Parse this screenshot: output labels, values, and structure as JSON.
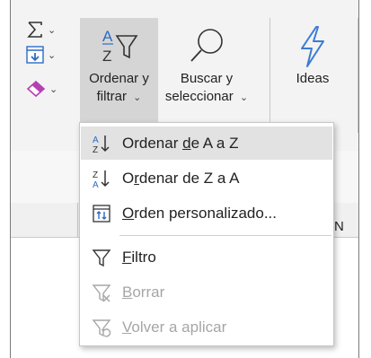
{
  "ribbon": {
    "autosum_icon": "sigma-icon",
    "fill_icon": "fill-down-icon",
    "clear_icon": "eraser-icon",
    "sort_filter": {
      "line1": "Ordenar y",
      "line2": "filtrar",
      "chevron": "⌄"
    },
    "find_select": {
      "line1": "Buscar y",
      "line2": "seleccionar",
      "chevron": "⌄"
    },
    "ideas": {
      "label": "Ideas"
    }
  },
  "sheet": {
    "column_letter": "N"
  },
  "menu": {
    "items": [
      {
        "label_pre": "Ordenar ",
        "label_key": "d",
        "label_post": "e A a Z",
        "icon": "sort-az-icon",
        "state": "hover"
      },
      {
        "label_pre": "O",
        "label_key": "r",
        "label_post": "denar de Z a A",
        "icon": "sort-za-icon",
        "state": "normal"
      },
      {
        "label_pre": "",
        "label_key": "O",
        "label_post": "rden personalizado...",
        "icon": "custom-sort-icon",
        "state": "normal"
      },
      {
        "label_pre": "",
        "label_key": "F",
        "label_post": "iltro",
        "icon": "filter-icon",
        "state": "normal"
      },
      {
        "label_pre": "",
        "label_key": "B",
        "label_post": "orrar",
        "icon": "clear-filter-icon",
        "state": "disabled"
      },
      {
        "label_pre": "",
        "label_key": "V",
        "label_post": "olver a aplicar",
        "icon": "reapply-filter-icon",
        "state": "disabled"
      }
    ]
  },
  "colors": {
    "accent_blue": "#2b6cc4",
    "lightning": "#3a7bd5",
    "eraser": "#b540b5",
    "disabled": "#a6a6a6"
  }
}
